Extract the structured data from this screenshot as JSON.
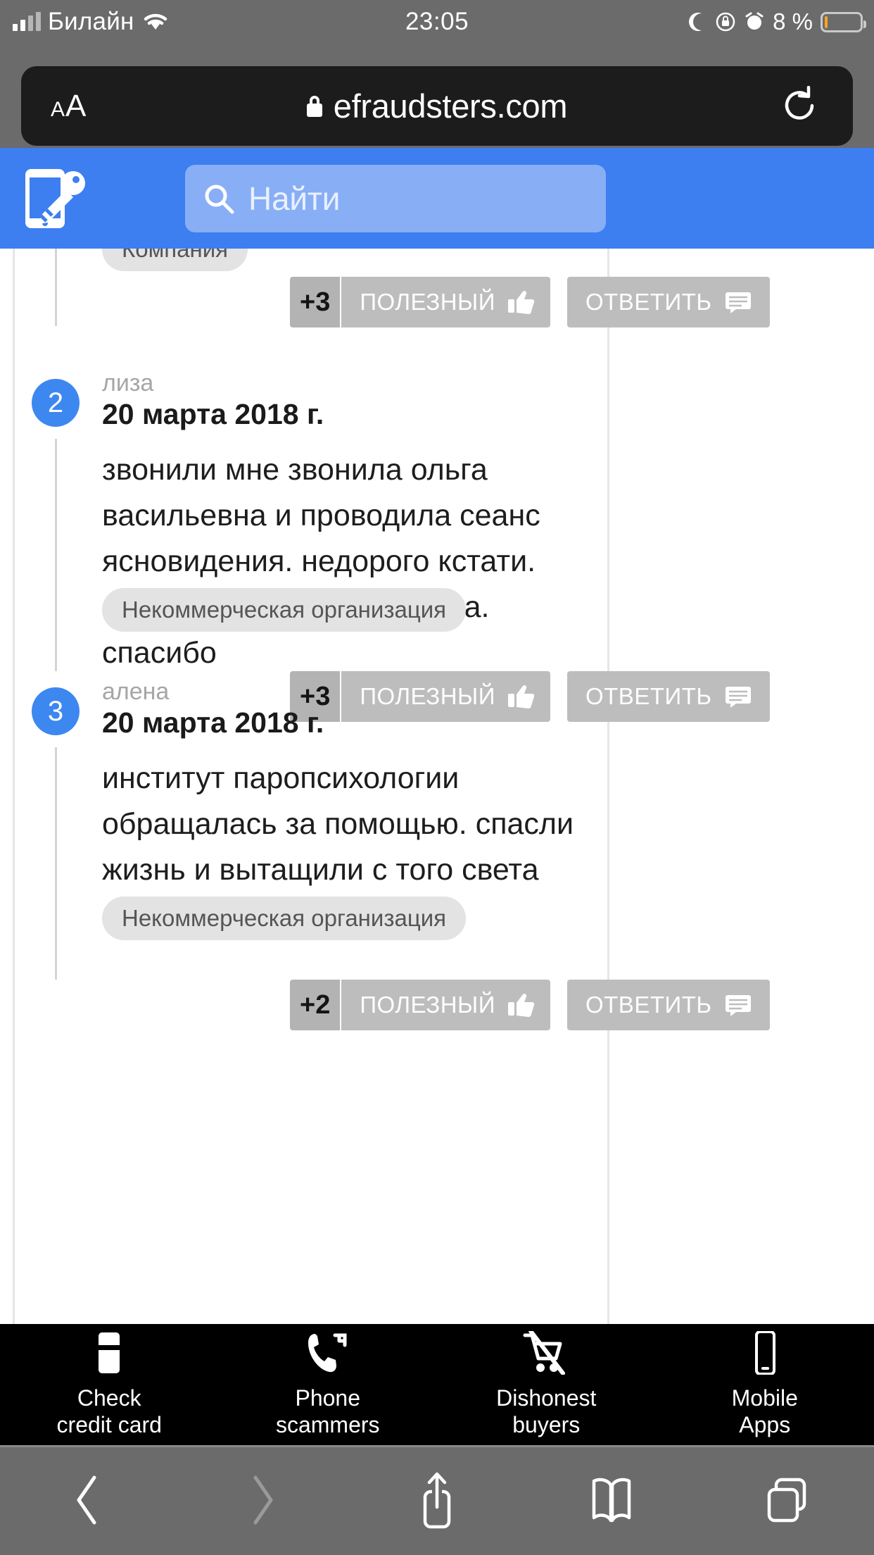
{
  "status_bar": {
    "carrier": "Билайн",
    "time": "23:05",
    "battery_percent": "8 %",
    "battery_level": 8,
    "icons": [
      "signal-bars-icon",
      "wifi-icon",
      "moon-icon",
      "rotation-lock-icon",
      "alarm-icon",
      "battery-icon"
    ]
  },
  "browser": {
    "text_size_small": "A",
    "text_size_large": "A",
    "url": "efraudsters.com",
    "lock_icon": "lock-icon",
    "reload_icon": "reload-icon",
    "toolbar": {
      "back": "back-icon",
      "forward": "forward-icon",
      "share": "share-icon",
      "bookmarks": "bookmarks-icon",
      "tabs": "tabs-icon"
    }
  },
  "site_header": {
    "logo": "phone-key-logo",
    "accent_color": "#3d7ef0",
    "search_field_color": "#88aef6",
    "search": {
      "icon": "search-icon",
      "placeholder": "Найти",
      "value": ""
    }
  },
  "comments": [
    {
      "index": "",
      "user": "",
      "date": "",
      "body": "",
      "tag": "Компания",
      "votes": "+3",
      "helpful_label": "ПОЛЕЗНЫЙ",
      "reply_label": "ОТВЕТИТЬ"
    },
    {
      "index": "2",
      "user": "лиза",
      "date": "20 марта 2018 г.",
      "body": "звонили мне звонила ольга васильевна и проводила сеанс ясновидения. недорого кстати. помогла и все мне сказала. спасибо",
      "tag": "Некоммерческая организация",
      "votes": "+3",
      "helpful_label": "ПОЛЕЗНЫЙ",
      "reply_label": "ОТВЕТИТЬ"
    },
    {
      "index": "3",
      "user": "алена",
      "date": "20 марта 2018 г.",
      "body": "институт паропсихологии обращалась за помощью. спасли жизнь и вытащили с того света",
      "tag": "Некоммерческая организация",
      "votes": "+2",
      "helpful_label": "ПОЛЕЗНЫЙ",
      "reply_label": "ОТВЕТИТЬ"
    }
  ],
  "app_bar": {
    "background": "#000000",
    "items": [
      {
        "icon": "credit-card-icon",
        "line1": "Check",
        "line2": "credit card"
      },
      {
        "icon": "phone-scammer-icon",
        "line1": "Phone",
        "line2": "scammers"
      },
      {
        "icon": "cart-crossed-icon",
        "line1": "Dishonest",
        "line2": "buyers"
      },
      {
        "icon": "mobile-phone-icon",
        "line1": "Mobile",
        "line2": "Apps"
      }
    ]
  }
}
